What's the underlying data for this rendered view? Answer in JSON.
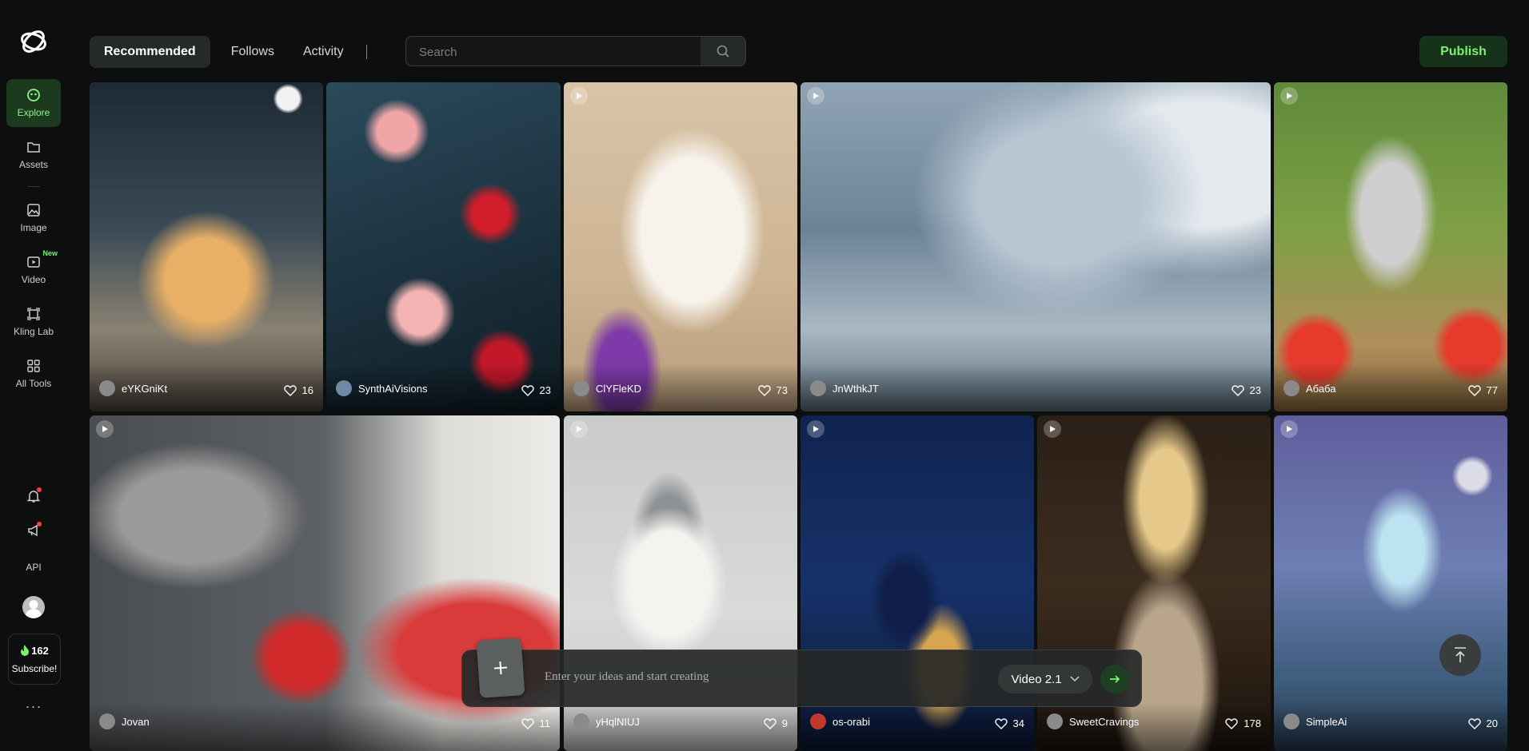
{
  "sidebar": {
    "items": [
      {
        "label": "Explore",
        "icon": "explore-icon",
        "active": true
      },
      {
        "label": "Assets",
        "icon": "folder-icon"
      },
      {
        "label": "Image",
        "icon": "image-icon"
      },
      {
        "label": "Video",
        "icon": "video-icon",
        "badge": "New"
      },
      {
        "label": "Kling Lab",
        "icon": "lab-icon"
      },
      {
        "label": "All Tools",
        "icon": "grid-icon"
      }
    ],
    "api_label": "API",
    "credits": "162",
    "subscribe_label": "Subscribe!",
    "more_label": "···"
  },
  "header": {
    "tabs": [
      "Recommended",
      "Follows",
      "Activity"
    ],
    "active_tab": "Recommended",
    "search_placeholder": "Search",
    "publish_label": "Publish"
  },
  "feed": {
    "cards": [
      {
        "user": "eYKGniKt",
        "likes": "16",
        "video": false
      },
      {
        "user": "SynthAiVisions",
        "likes": "23",
        "video": false
      },
      {
        "user": "ClYFleKD",
        "likes": "73",
        "video": true
      },
      {
        "user": "JnWthkJT",
        "likes": "23",
        "video": true
      },
      {
        "user": "Абаба",
        "likes": "77",
        "video": true
      },
      {
        "user": "Jovan",
        "likes": "11",
        "video": true
      },
      {
        "user": "yHqlNIUJ",
        "likes": "9",
        "video": true
      },
      {
        "user": "os-orabi",
        "likes": "34",
        "video": true
      },
      {
        "user": "SweetCravings",
        "likes": "178",
        "video": true
      },
      {
        "user": "SimpleAi",
        "likes": "20",
        "video": true
      }
    ]
  },
  "prompt": {
    "placeholder": "Enter your ideas and start creating",
    "model": "Video 2.1"
  },
  "colors": {
    "accent": "#7cf06f",
    "background": "#0d0f0e",
    "notification": "#ff3b3b"
  }
}
